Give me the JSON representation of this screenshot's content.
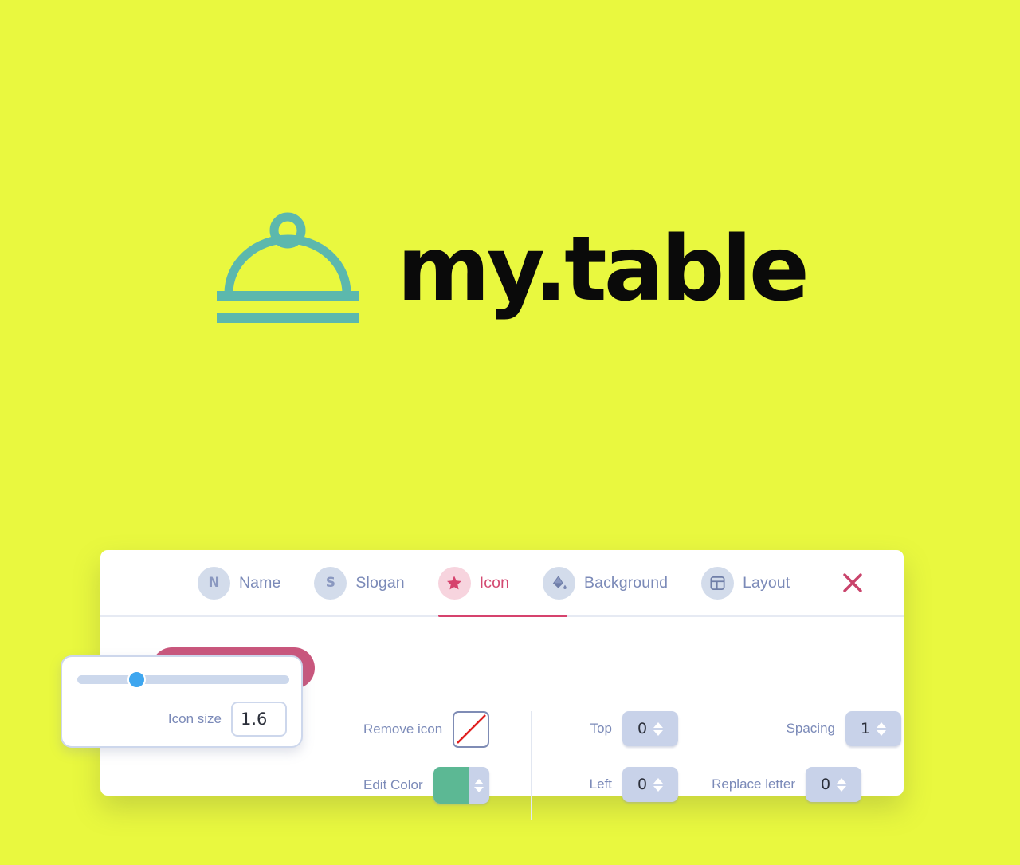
{
  "canvas": {
    "background_color": "#e9f83f",
    "logo": {
      "icon_name": "cloche-serving-dome-icon",
      "icon_color": "#5cb8ad",
      "text": "my.table",
      "text_color": "#0a0a0a"
    }
  },
  "panel": {
    "tabs": [
      {
        "key": "name",
        "badge": "N",
        "icon_name": "letter-n-badge-icon",
        "label": "Name",
        "active": false
      },
      {
        "key": "slogan",
        "badge": "S",
        "icon_name": "letter-s-badge-icon",
        "label": "Slogan",
        "active": false
      },
      {
        "key": "icon",
        "badge": "",
        "icon_name": "star-icon",
        "label": "Icon",
        "active": true
      },
      {
        "key": "background",
        "badge": "",
        "icon_name": "paint-bucket-icon",
        "label": "Background",
        "active": false
      },
      {
        "key": "layout",
        "badge": "",
        "icon_name": "layout-grid-icon",
        "label": "Layout",
        "active": false
      }
    ],
    "close": {
      "icon_name": "close-x-icon",
      "label": "",
      "color": "#c9436b"
    },
    "active_tab_color": "#d6436d",
    "inactive_tab_color": "#7b8ab8",
    "add_icon_button": {
      "label": "",
      "color": "#c9577d"
    },
    "controls": {
      "remove_icon": {
        "label": "Remove icon",
        "icon_name": "no-icon-slash-swatch",
        "slash_color": "#e02020"
      },
      "edit_color": {
        "label": "Edit Color",
        "value": "#5cb894",
        "icon_name": "color-swatch-stepper"
      },
      "top": {
        "label": "Top",
        "value": "0"
      },
      "left": {
        "label": "Left",
        "value": "0"
      },
      "spacing": {
        "label": "Spacing",
        "value": "1"
      },
      "replace_letter": {
        "label": "Replace letter",
        "value": "0"
      }
    }
  },
  "icon_size_popup": {
    "label": "Icon size",
    "value": "1.6",
    "placeholder": "1.6",
    "slider": {
      "percent": 26,
      "thumb_color": "#3ea6ef",
      "track_color": "#ccd8ec"
    }
  }
}
